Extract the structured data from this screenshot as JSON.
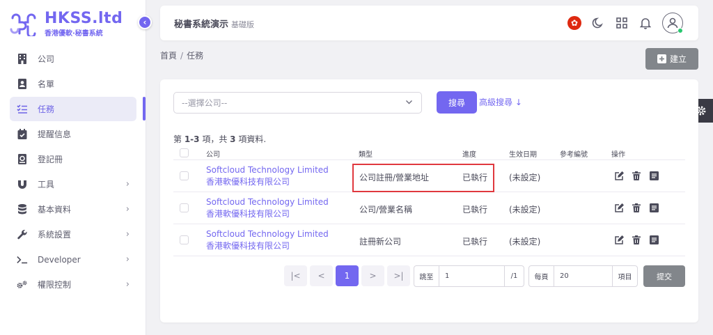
{
  "brand": {
    "name": "HKSS.ltd",
    "tagline": "香港優軟·秘書系統",
    "accent": "#7367f0"
  },
  "sidebar": {
    "items": [
      {
        "label": "公司",
        "icon": "building-icon",
        "active": false,
        "expandable": false
      },
      {
        "label": "名單",
        "icon": "contact-card-icon",
        "active": false,
        "expandable": false
      },
      {
        "label": "任務",
        "icon": "checklist-icon",
        "active": true,
        "expandable": false
      },
      {
        "label": "提醒信息",
        "icon": "calendar-check-icon",
        "active": false,
        "expandable": false
      },
      {
        "label": "登記冊",
        "icon": "register-book-icon",
        "active": false,
        "expandable": false
      },
      {
        "label": "工具",
        "icon": "magnet-icon",
        "active": false,
        "expandable": true
      },
      {
        "label": "基本資料",
        "icon": "database-icon",
        "active": false,
        "expandable": true
      },
      {
        "label": "系統設置",
        "icon": "wrench-icon",
        "active": false,
        "expandable": true
      },
      {
        "label": "Developer",
        "icon": "terminal-icon",
        "active": false,
        "expandable": true
      },
      {
        "label": "權限控制",
        "icon": "gears-icon",
        "active": false,
        "expandable": true
      }
    ]
  },
  "header": {
    "title": "秘書系統演示",
    "edition": "基礎版"
  },
  "breadcrumb": {
    "home": "首頁",
    "separator": "/",
    "current": "任務"
  },
  "toolbar": {
    "create_label": "建立"
  },
  "filter": {
    "company_placeholder": "--選擇公司--",
    "search_label": "搜尋",
    "advanced_label": "高級搜尋"
  },
  "summary": {
    "prefix": "第 ",
    "range": "1-3",
    "middle": " 項，共 ",
    "total": "3",
    "suffix": " 項資料."
  },
  "table": {
    "headers": {
      "company": "公司",
      "type": "類型",
      "progress": "進度",
      "effective_date": "生效日期",
      "reference": "參考編號",
      "actions": "操作"
    },
    "rows": [
      {
        "company_en": "Softcloud Technology Limited",
        "company_zh": "香港軟優科技有限公司",
        "type": "公司註冊/營業地址",
        "progress": "已執行",
        "effective_date": "(未設定)",
        "reference": ""
      },
      {
        "company_en": "Softcloud Technology Limited",
        "company_zh": "香港軟優科技有限公司",
        "type": "公司/營業名稱",
        "progress": "已執行",
        "effective_date": "(未設定)",
        "reference": ""
      },
      {
        "company_en": "Softcloud Technology Limited",
        "company_zh": "香港軟優科技有限公司",
        "type": "註冊新公司",
        "progress": "已執行",
        "effective_date": "(未設定)",
        "reference": ""
      }
    ]
  },
  "pagination": {
    "first": "|<",
    "prev": "<",
    "current_page": "1",
    "next": ">",
    "last": ">|",
    "jump_label": "跳至",
    "jump_value": "1",
    "jump_suffix": "/1",
    "per_page_label": "每頁",
    "per_page_value": "20",
    "per_page_suffix": "項目",
    "submit_label": "提交"
  }
}
